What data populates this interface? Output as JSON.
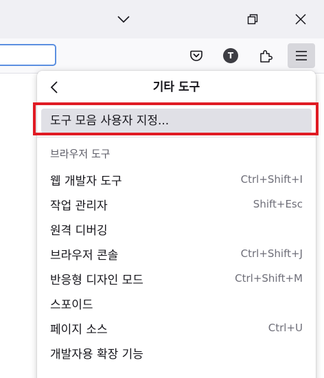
{
  "titlebar": {
    "icons": {
      "tab_list": "chevron-down-icon",
      "restore": "restore-window-icon",
      "close": "close-icon"
    }
  },
  "toolbar": {
    "account_initial": "T",
    "icons": {
      "pocket": "pocket-icon",
      "extensions": "puzzle-piece-icon",
      "menu": "hamburger-menu-icon"
    }
  },
  "panel": {
    "title": "기타 도구",
    "back_icon": "back-arrow-icon",
    "customize_label": "도구 모음 사용자 지정...",
    "section_header": "브라우저 도구",
    "items": [
      {
        "label": "웹 개발자 도구",
        "shortcut": "Ctrl+Shift+I"
      },
      {
        "label": "작업 관리자",
        "shortcut": "Shift+Esc"
      },
      {
        "label": "원격 디버깅",
        "shortcut": ""
      },
      {
        "label": "브라우저 콘솔",
        "shortcut": "Ctrl+Shift+J"
      },
      {
        "label": "반응형 디자인 모드",
        "shortcut": "Ctrl+Shift+M"
      },
      {
        "label": "스포이드",
        "shortcut": ""
      },
      {
        "label": "페이지 소스",
        "shortcut": "Ctrl+U"
      },
      {
        "label": "개발자용 확장 기능",
        "shortcut": ""
      }
    ]
  },
  "colors": {
    "titlebar_bg": "#f0f0f4",
    "toolbar_bg": "#f9f9fb",
    "urlbar_focus_border": "#5b8fe0",
    "highlight_border": "#e01b24",
    "hover_bg": "#e0e0e6",
    "menu_button_active_bg": "#d7d7dc"
  }
}
